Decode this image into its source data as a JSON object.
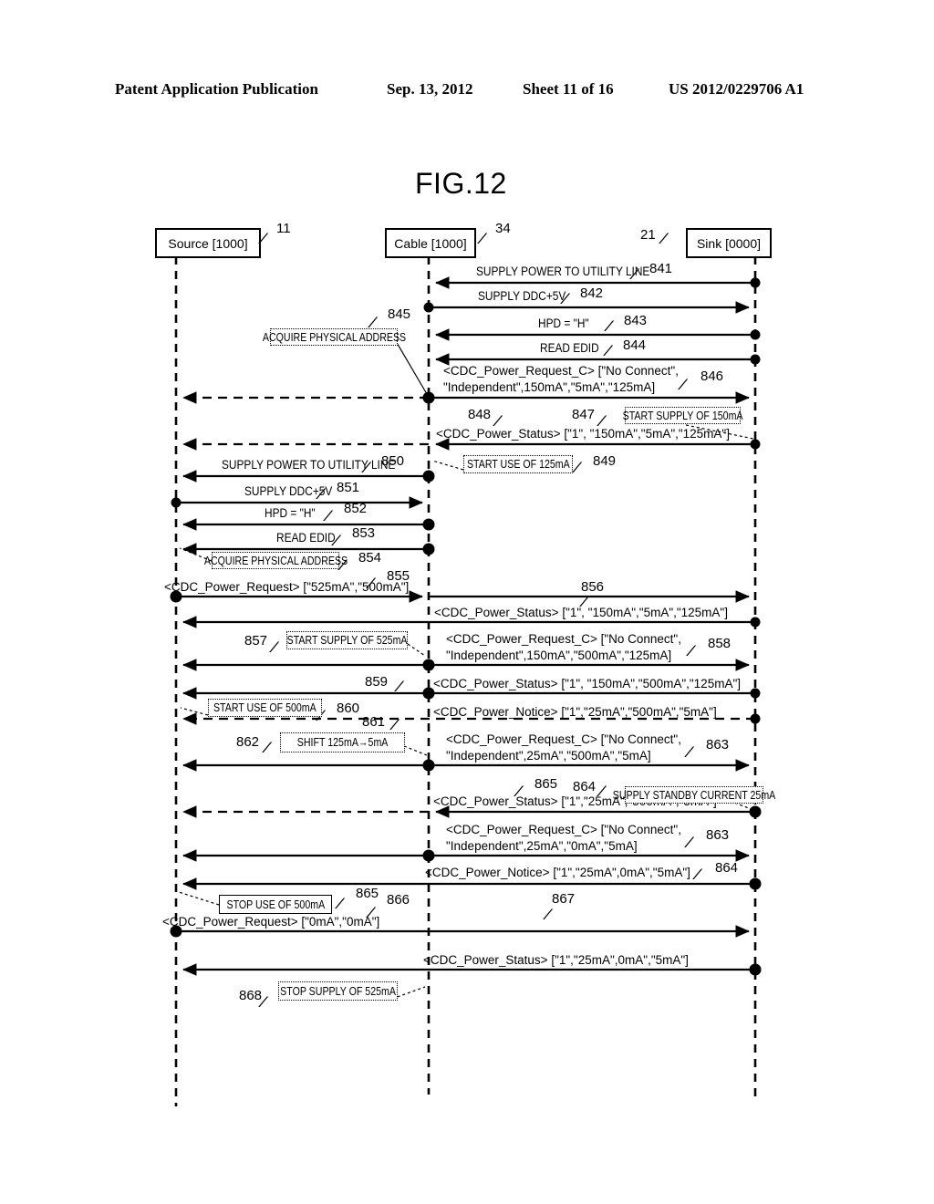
{
  "page_header": {
    "publication": "Patent Application Publication",
    "date": "Sep. 13, 2012",
    "sheet": "Sheet 11 of 16",
    "patent_number": "US 2012/0229706 A1"
  },
  "figure": {
    "label": "FIG.12",
    "type": "sequence-diagram"
  },
  "actors": [
    {
      "id": "source",
      "label": "Source [1000]",
      "ref": "11"
    },
    {
      "id": "cable",
      "label": "Cable [1000]",
      "ref": "34"
    },
    {
      "id": "sink",
      "label": "Sink [0000]",
      "ref": "21"
    }
  ],
  "messages": [
    {
      "ref": "841",
      "text": "SUPPLY POWER TO UTILITY LINE",
      "from": "sink",
      "to": "cable",
      "style": "solid"
    },
    {
      "ref": "842",
      "text": "SUPPLY DDC+5V",
      "from": "cable",
      "to": "sink",
      "style": "solid"
    },
    {
      "ref": "843",
      "text": "HPD = \"H\"",
      "from": "sink",
      "to": "cable",
      "style": "solid"
    },
    {
      "ref": "844",
      "text": "READ EDID",
      "from": "sink",
      "to": "cable",
      "style": "solid"
    },
    {
      "ref": "846",
      "text_line1": "<CDC_Power_Request_C> [\"No Connect\",",
      "text_line2": "\"Independent\",150mA\",\"5mA\",\"125mA]",
      "from": "cable",
      "to": "sink",
      "style": "solid"
    },
    {
      "ref": "848",
      "text": "<CDC_Power_Status> [\"1\", \"150mA\",\"5mA\",\"125mA\"]",
      "from": "sink",
      "to": "cable",
      "style": "solid"
    },
    {
      "ref": "850",
      "text": "SUPPLY POWER TO UTILITY LINE",
      "from": "cable",
      "to": "source",
      "style": "solid"
    },
    {
      "ref": "851",
      "text": "SUPPLY DDC+5V",
      "from": "source",
      "to": "cable",
      "style": "solid"
    },
    {
      "ref": "852",
      "text": "HPD = \"H\"",
      "from": "cable",
      "to": "source",
      "style": "solid"
    },
    {
      "ref": "853",
      "text": "READ EDID",
      "from": "cable",
      "to": "source",
      "style": "solid"
    },
    {
      "ref": "855",
      "text": "<CDC_Power_Request> [\"525mA\",\"500mA\"]",
      "from": "source",
      "to": "cable",
      "style": "solid"
    },
    {
      "ref": "856",
      "text": "<CDC_Power_Status> [\"1\", \"150mA\",\"5mA\",\"125mA\"]",
      "from": "cable",
      "to": "sink",
      "style": "solid"
    },
    {
      "ref": "858",
      "text_line1": "<CDC_Power_Request_C> [\"No Connect\",",
      "text_line2": "\"Independent\",150mA\",\"500mA\",\"125mA]",
      "from": "cable",
      "to": "sink",
      "style": "solid"
    },
    {
      "ref": "859",
      "text": "<CDC_Power_Status> [\"1\", \"150mA\",\"500mA\",\"125mA\"]",
      "from": "sink",
      "to": "source",
      "style": "solid"
    },
    {
      "ref": "861",
      "text": "<CDC_Power_Notice> [\"1\",\"25mA\",\"500mA\",\"5mA\"]",
      "from": "sink",
      "to": "source",
      "style": "dashed"
    },
    {
      "ref": "863",
      "text_line1": "<CDC_Power_Request_C> [\"No Connect\",",
      "text_line2": "\"Independent\",25mA\",\"500mA\",\"5mA]",
      "from": "source",
      "to": "sink",
      "style": "solid"
    },
    {
      "ref": "865",
      "text": "<CDC_Power_Status> [\"1\",\"25mA\",\"500mA\",\"5mA\"]",
      "from": "sink",
      "to": "source",
      "style": "dashed"
    },
    {
      "ref": "863b",
      "ref_display": "863",
      "text_line1": "<CDC_Power_Request_C> [\"No Connect\",",
      "text_line2": "\"Independent\",25mA\",\"0mA\",\"5mA]",
      "from": "cable",
      "to": "sink",
      "style": "solid"
    },
    {
      "ref": "864b",
      "ref_display": "864",
      "text": "<CDC_Power_Notice> [\"1\",\"25mA\",0mA\",\"5mA\"]",
      "from": "sink",
      "to": "source",
      "style": "solid"
    },
    {
      "ref": "866",
      "text": "<CDC_Power_Request> [\"0mA\",\"0mA\"]",
      "from": "source",
      "to": "sink",
      "style": "solid"
    },
    {
      "ref": "867",
      "text": "<CDC_Power_Status> [\"1\",\"25mA\",0mA\",\"5mA\"]",
      "from": "sink",
      "to": "source",
      "style": "solid"
    }
  ],
  "actions": [
    {
      "ref": "845",
      "text": "ACQUIRE PHYSICAL ADDRESS",
      "lane": "cable-left"
    },
    {
      "ref": "847",
      "text": "START SUPPLY OF 150mA",
      "lane": "sink"
    },
    {
      "ref": "849",
      "text": "START USE OF 125mA",
      "lane": "cable-right"
    },
    {
      "ref": "854",
      "text": "ACQUIRE PHYSICAL ADDRESS",
      "lane": "source"
    },
    {
      "ref": "857",
      "text": "START SUPPLY OF 525mA",
      "lane": "source"
    },
    {
      "ref": "860",
      "text": "START USE OF 500mA",
      "lane": "source"
    },
    {
      "ref": "862",
      "text": "SHIFT 125mA→5mA",
      "lane": "source"
    },
    {
      "ref": "864",
      "text": "SUPPLY STANDBY CURRENT 25mA",
      "lane": "sink"
    },
    {
      "ref": "865b",
      "ref_display": "865",
      "text": "STOP USE OF 500mA",
      "lane": "source"
    },
    {
      "ref": "868",
      "text": "STOP SUPPLY OF 525mA",
      "lane": "source"
    }
  ],
  "colors": {
    "ink": "#000000",
    "paper": "#ffffff"
  }
}
